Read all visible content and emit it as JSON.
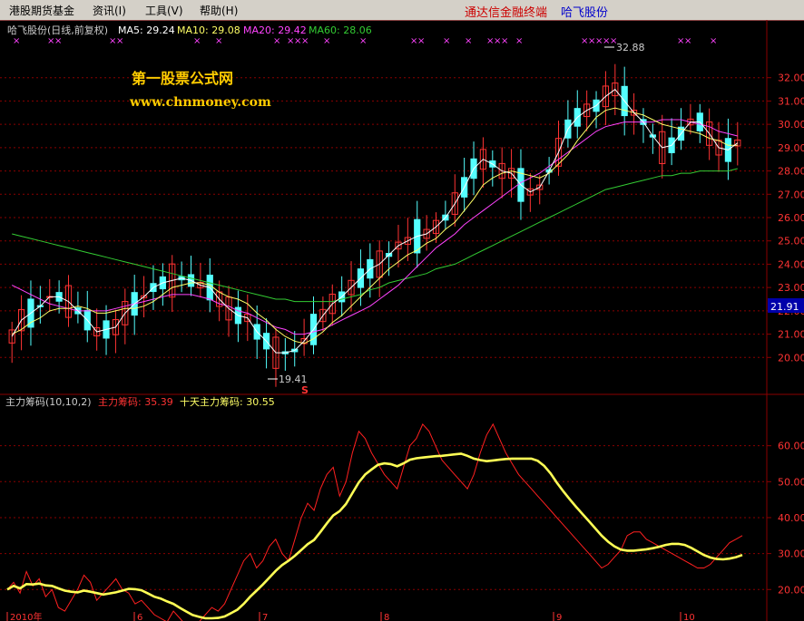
{
  "menu": {
    "items": [
      "港股期货基金",
      "资讯(I)",
      "工具(V)",
      "帮助(H)"
    ],
    "right_text": "通达信金融终端",
    "right_stock": "哈飞股份"
  },
  "header": {
    "title": "哈飞股份(日线,前复权)",
    "ma": [
      {
        "label": "MA5: 29.24",
        "color": "#ffffff"
      },
      {
        "label": "MA10: 29.08",
        "color": "#ffff66"
      },
      {
        "label": "MA20: 29.42",
        "color": "#ff44ff"
      },
      {
        "label": "MA60: 28.06",
        "color": "#33cc33"
      }
    ]
  },
  "watermark": {
    "line1": "第一股票公式网",
    "line2": "www.chnmoney.com"
  },
  "annotations": {
    "high": "32.88",
    "low": "19.41",
    "signal": "S",
    "current_price": "21.91"
  },
  "price_axis": [
    "32.00",
    "31.00",
    "30.00",
    "29.00",
    "28.00",
    "27.00",
    "26.00",
    "25.00",
    "24.00",
    "23.00",
    "22.00",
    "21.00",
    "20.00"
  ],
  "indicator": {
    "title": "主力筹码(10,10,2)",
    "main_label": "主力筹码: 35.39",
    "ten_label": "十天主力筹码: 30.55",
    "axis": [
      "60.00",
      "50.00",
      "40.00",
      "30.00",
      "20.00"
    ]
  },
  "bottom_axis": {
    "labels": [
      "2010年",
      "6",
      "7",
      "8",
      "9",
      "10"
    ]
  },
  "colors": {
    "up": "#ff3333",
    "down": "#54ffff",
    "ma5": "#ffffff",
    "ma10": "#ffff66",
    "ma20": "#ff44ff",
    "ma60": "#33cc33",
    "indicator_main": "#ff2020",
    "indicator_ten": "#ffff55",
    "grid": "#8b0000",
    "marker": "#ff44ff"
  },
  "chart_data": {
    "type": "line",
    "price": {
      "ylim": [
        19,
        33
      ],
      "ma5": [
        20.9,
        21.6,
        21.9,
        22.2,
        22.6,
        22.6,
        22.4,
        22.0,
        21.6,
        21.1,
        21.2,
        21.3,
        21.9,
        22.3,
        22.6,
        23.0,
        23.2,
        23.3,
        23.4,
        23.3,
        23.1,
        23.0,
        22.5,
        22.1,
        21.8,
        21.7,
        21.1,
        20.7,
        20.2,
        20.2,
        20.3,
        20.7,
        21.2,
        21.8,
        22.3,
        22.6,
        23.0,
        23.4,
        23.8,
        24.0,
        24.4,
        24.8,
        25.0,
        25.2,
        25.3,
        25.6,
        26.0,
        26.6,
        27.3,
        28.1,
        28.5,
        28.3,
        28.0,
        27.9,
        27.4,
        27.1,
        27.3,
        28.0,
        28.8,
        29.8,
        30.3,
        30.6,
        30.8,
        31.2,
        31.5,
        31.0,
        30.5,
        30.1,
        29.5,
        29.0,
        29.1,
        29.6,
        30.1,
        30.1,
        29.6,
        29.0,
        28.9,
        29.2
      ],
      "ma10": [
        21.0,
        21.2,
        21.5,
        21.7,
        22.0,
        22.1,
        22.1,
        22.2,
        22.1,
        21.9,
        21.9,
        22.0,
        22.1,
        22.1,
        22.2,
        22.4,
        22.7,
        23.0,
        23.1,
        23.2,
        23.2,
        23.1,
        22.8,
        22.6,
        22.5,
        22.3,
        21.9,
        21.6,
        21.2,
        20.9,
        20.7,
        20.6,
        20.8,
        21.1,
        21.5,
        21.8,
        22.2,
        22.6,
        23.0,
        23.4,
        23.8,
        24.1,
        24.4,
        24.6,
        24.9,
        25.1,
        25.5,
        25.8,
        26.3,
        26.8,
        27.4,
        27.7,
        27.9,
        28.0,
        27.9,
        27.8,
        27.7,
        27.9,
        28.3,
        28.7,
        29.3,
        29.8,
        30.3,
        30.6,
        30.7,
        30.6,
        30.5,
        30.4,
        30.2,
        30.0,
        29.9,
        29.8,
        29.7,
        29.6,
        29.4,
        29.3,
        29.1,
        29.1
      ],
      "ma20": [
        23.1,
        22.9,
        22.7,
        22.5,
        22.3,
        22.2,
        22.1,
        22.0,
        22.0,
        22.0,
        22.0,
        22.1,
        22.2,
        22.3,
        22.4,
        22.5,
        22.6,
        22.7,
        22.7,
        22.7,
        22.6,
        22.5,
        22.3,
        22.2,
        22.0,
        21.9,
        21.7,
        21.5,
        21.3,
        21.2,
        21.0,
        21.0,
        21.1,
        21.2,
        21.4,
        21.6,
        21.8,
        22.0,
        22.2,
        22.5,
        22.8,
        23.1,
        23.5,
        23.9,
        24.3,
        24.7,
        25.0,
        25.3,
        25.7,
        26.0,
        26.3,
        26.6,
        26.9,
        27.2,
        27.5,
        27.7,
        27.9,
        28.2,
        28.5,
        28.8,
        29.1,
        29.4,
        29.7,
        29.9,
        30.0,
        30.1,
        30.1,
        30.1,
        30.1,
        30.2,
        30.2,
        30.2,
        30.1,
        30.0,
        29.9,
        29.7,
        29.6,
        29.5
      ],
      "ma60": [
        25.3,
        25.2,
        25.1,
        25.0,
        24.9,
        24.8,
        24.7,
        24.6,
        24.5,
        24.4,
        24.3,
        24.2,
        24.1,
        24.0,
        23.9,
        23.8,
        23.7,
        23.6,
        23.5,
        23.4,
        23.3,
        23.2,
        23.1,
        23.0,
        22.9,
        22.8,
        22.7,
        22.6,
        22.5,
        22.5,
        22.4,
        22.4,
        22.4,
        22.4,
        22.4,
        22.5,
        22.6,
        22.7,
        22.9,
        23.0,
        23.2,
        23.3,
        23.4,
        23.5,
        23.6,
        23.8,
        23.9,
        24.0,
        24.2,
        24.4,
        24.6,
        24.8,
        25.0,
        25.2,
        25.4,
        25.6,
        25.8,
        26.0,
        26.2,
        26.4,
        26.6,
        26.8,
        27.0,
        27.2,
        27.3,
        27.4,
        27.5,
        27.6,
        27.7,
        27.8,
        27.8,
        27.9,
        27.9,
        28.0,
        28.0,
        28.0,
        28.0,
        28.1
      ]
    },
    "indicator": {
      "ylim": [
        12,
        70
      ],
      "main": [
        20,
        22,
        19,
        25,
        21,
        23,
        18,
        20,
        15,
        14,
        17,
        20,
        24,
        22,
        17,
        19,
        21,
        23,
        20,
        19,
        16,
        17,
        15,
        13,
        12,
        11,
        14,
        12,
        10,
        9,
        11,
        13,
        15,
        14,
        16,
        20,
        24,
        28,
        30,
        26,
        28,
        32,
        34,
        30,
        28,
        34,
        40,
        44,
        42,
        48,
        52,
        54,
        46,
        50,
        58,
        64,
        62,
        58,
        55,
        52,
        50,
        48,
        54,
        60,
        62,
        66,
        64,
        60,
        56,
        54,
        52,
        50,
        48,
        52,
        58,
        63,
        66,
        62,
        58,
        55,
        52,
        50,
        48,
        46,
        44,
        42,
        40,
        38,
        36,
        34,
        32,
        30,
        28,
        26,
        27,
        29,
        31,
        35,
        36,
        36,
        34,
        33,
        32,
        31,
        30,
        29,
        28,
        27,
        26,
        26,
        27,
        29,
        31,
        33,
        34,
        35
      ]
    }
  }
}
